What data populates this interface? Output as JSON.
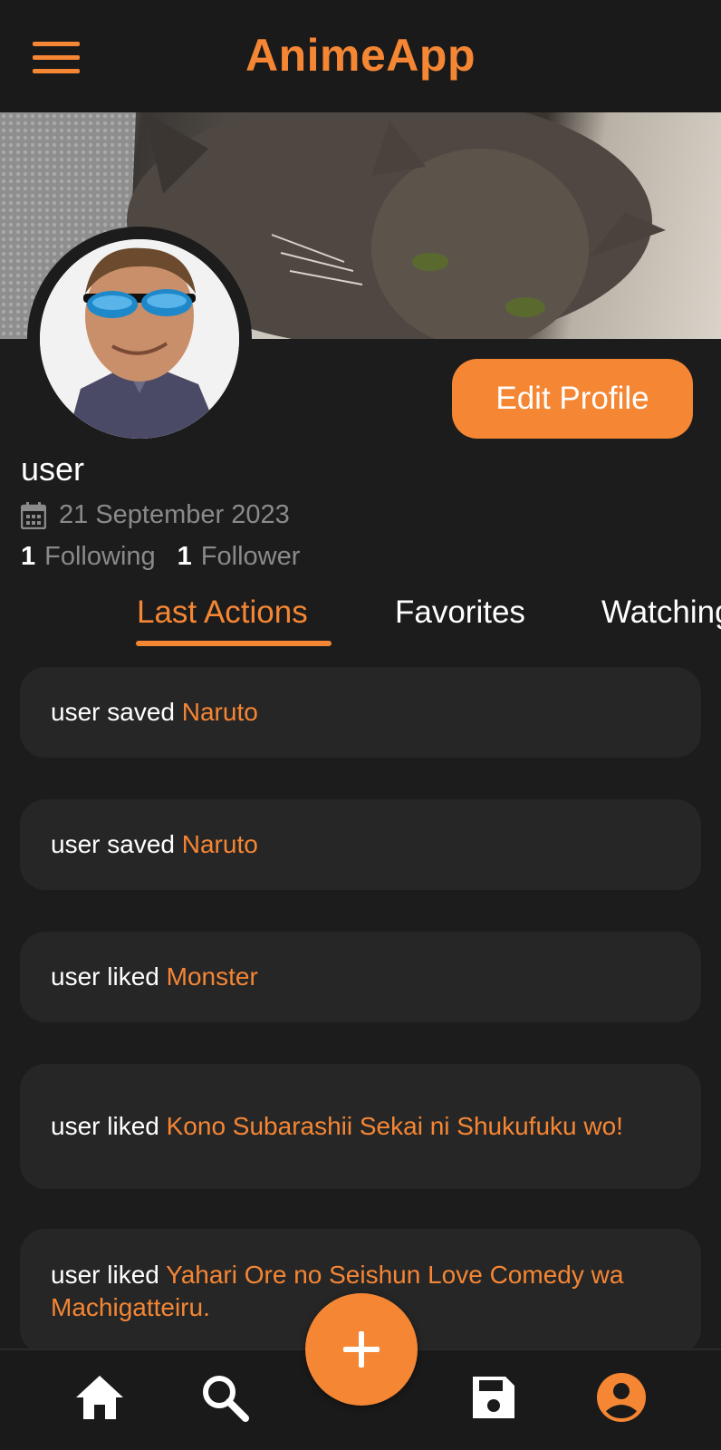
{
  "app": {
    "title": "AnimeApp"
  },
  "header": {
    "menu_icon": "hamburger-menu-icon"
  },
  "profile": {
    "username": "user",
    "joined_date": "21 September 2023",
    "following_count": "1",
    "following_label": "Following",
    "followers_count": "1",
    "followers_label": "Follower",
    "edit_button_label": "Edit Profile",
    "banner_image": "cat-banner",
    "avatar_image": "user-avatar-sunglasses"
  },
  "tabs": [
    {
      "label": "Last Actions",
      "active": true
    },
    {
      "label": "Favorites",
      "active": false
    },
    {
      "label": "Watching",
      "active": false
    }
  ],
  "actions": [
    {
      "text": "user saved ",
      "title": "Naruto"
    },
    {
      "text": "user saved ",
      "title": "Naruto"
    },
    {
      "text": "user liked ",
      "title": "Monster"
    },
    {
      "text": "user liked ",
      "title": "Kono Subarashii Sekai ni Shukufuku wo!"
    },
    {
      "text": "user liked ",
      "title": "Yahari Ore no Seishun Love Comedy wa Machigatteiru."
    }
  ],
  "bottom_nav": {
    "items": [
      {
        "icon": "home-icon"
      },
      {
        "icon": "search-icon"
      },
      {
        "icon": "add-icon"
      },
      {
        "icon": "save-icon"
      },
      {
        "icon": "profile-icon",
        "active": true
      }
    ]
  },
  "colors": {
    "accent": "#f58634",
    "background": "#1c1c1c",
    "card": "#262626",
    "muted": "#8a8a8a"
  }
}
